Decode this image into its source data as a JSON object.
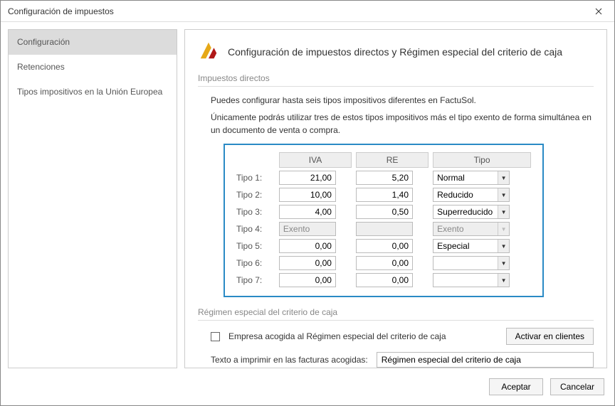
{
  "window": {
    "title": "Configuración de impuestos"
  },
  "sidebar": {
    "items": [
      {
        "label": "Configuración",
        "active": true
      },
      {
        "label": "Retenciones",
        "active": false
      },
      {
        "label": "Tipos impositivos en la Unión Europea",
        "active": false
      }
    ]
  },
  "main": {
    "header": "Configuración de impuestos directos y Régimen especial del criterio de caja",
    "section_direct": "Impuestos directos",
    "desc1": "Puedes configurar hasta seis tipos impositivos diferentes en FactuSol.",
    "desc2": "Únicamente podrás utilizar tres de estos tipos impositivos más el tipo exento de forma simultánea en un documento de venta o compra.",
    "columns": {
      "iva": "IVA",
      "re": "RE",
      "tipo": "Tipo"
    },
    "rows": [
      {
        "label": "Tipo 1:",
        "iva": "21,00",
        "re": "5,20",
        "tipo": "Normal",
        "readonly": false
      },
      {
        "label": "Tipo 2:",
        "iva": "10,00",
        "re": "1,40",
        "tipo": "Reducido",
        "readonly": false
      },
      {
        "label": "Tipo 3:",
        "iva": "4,00",
        "re": "0,50",
        "tipo": "Superreducido",
        "readonly": false
      },
      {
        "label": "Tipo 4:",
        "iva": "Exento",
        "re": "",
        "tipo": "Exento",
        "readonly": true
      },
      {
        "label": "Tipo 5:",
        "iva": "0,00",
        "re": "0,00",
        "tipo": "Especial",
        "readonly": false
      },
      {
        "label": "Tipo 6:",
        "iva": "0,00",
        "re": "0,00",
        "tipo": "",
        "readonly": false
      },
      {
        "label": "Tipo 7:",
        "iva": "0,00",
        "re": "0,00",
        "tipo": "",
        "readonly": false
      }
    ],
    "section_regime": "Régimen especial del criterio de caja",
    "chk_label": "Empresa acogida al Régimen especial del criterio de caja",
    "activate_btn": "Activar en clientes",
    "print_label": "Texto a imprimir en las facturas acogidas:",
    "print_value": "Régimen especial del criterio de caja"
  },
  "footer": {
    "ok": "Aceptar",
    "cancel": "Cancelar"
  }
}
